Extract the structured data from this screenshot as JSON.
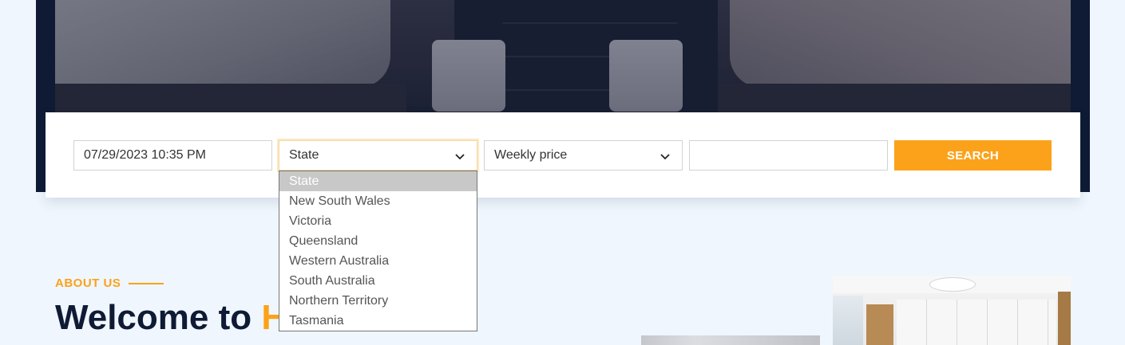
{
  "search": {
    "date_value": "07/29/2023 10:35 PM",
    "state_selected": "State",
    "price_selected": "Weekly price",
    "keyword_value": "",
    "search_label": "SEARCH"
  },
  "state_options": [
    "State",
    "New South Wales",
    "Victoria",
    "Queensland",
    "Western Australia",
    "South Australia",
    "Northern Territory",
    "Tasmania"
  ],
  "about": {
    "eyebrow": "ABOUT US",
    "heading_prefix": "Welcome to ",
    "heading_accent": "H"
  },
  "colors": {
    "accent": "#fba21a",
    "navy": "#0f1b35",
    "background": "#eff6fd"
  },
  "icons": {
    "state_chevron": "chevron-down-icon",
    "price_chevron": "chevron-down-icon"
  }
}
